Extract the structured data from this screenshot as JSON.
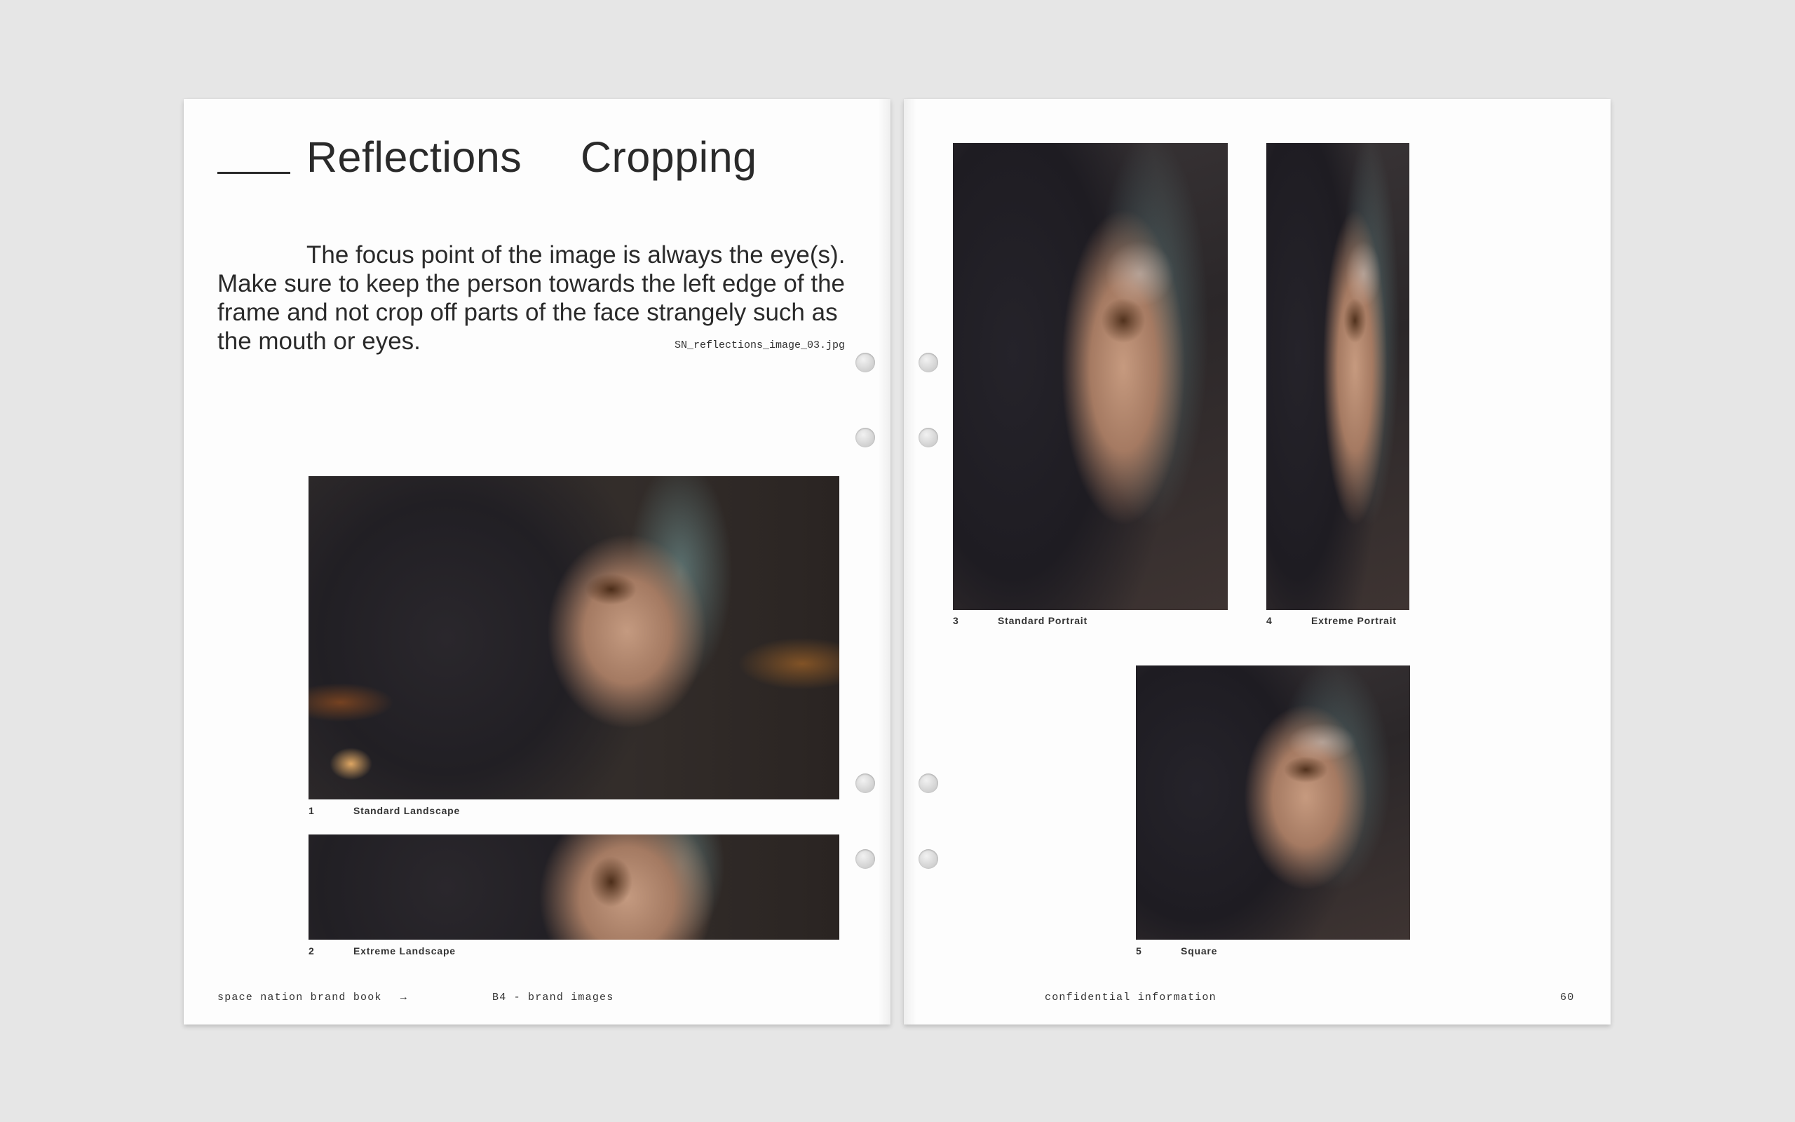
{
  "left_page": {
    "title_a": "Reflections",
    "title_b": "Cropping",
    "body": "The focus point of the image is always the eye(s). Make sure to keep the person towards the left edge of the frame and not crop off parts of the face strangely such as the mouth or eyes.",
    "filename": "SN_reflections_image_03.jpg",
    "figures": [
      {
        "num": "1",
        "label": "Standard Landscape"
      },
      {
        "num": "2",
        "label": "Extreme Landscape"
      }
    ],
    "footer": {
      "brand": "space nation brand book",
      "arrow": "→",
      "section": "B4 - brand images"
    }
  },
  "right_page": {
    "figures": [
      {
        "num": "3",
        "label": "Standard Portrait"
      },
      {
        "num": "4",
        "label": "Extreme Portrait"
      },
      {
        "num": "5",
        "label": "Square"
      }
    ],
    "footer": {
      "confidential": "confidential information",
      "page_number": "60"
    }
  }
}
